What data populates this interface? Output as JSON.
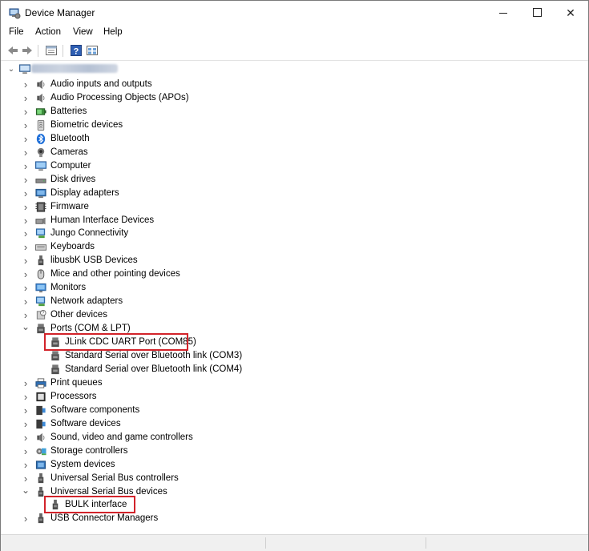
{
  "window": {
    "title": "Device Manager",
    "minimize_glyph": "—",
    "maximize_glyph": "☐",
    "close_glyph": "✕"
  },
  "menu": {
    "file": "File",
    "action": "Action",
    "view": "View",
    "help": "Help"
  },
  "toolbar": {
    "buttons": [
      "back-icon",
      "forward-icon",
      "properties-icon",
      "help-icon",
      "view-icon"
    ]
  },
  "tree": {
    "root": {
      "label_blurred": true,
      "expanded": true
    },
    "categories": [
      {
        "label": "Audio inputs and outputs",
        "icon": "speaker-icon",
        "expanded": false
      },
      {
        "label": "Audio Processing Objects (APOs)",
        "icon": "speaker-icon",
        "expanded": false
      },
      {
        "label": "Batteries",
        "icon": "battery-icon",
        "expanded": false
      },
      {
        "label": "Biometric devices",
        "icon": "fingerprint-icon",
        "expanded": false
      },
      {
        "label": "Bluetooth",
        "icon": "bluetooth-icon",
        "expanded": false
      },
      {
        "label": "Cameras",
        "icon": "camera-icon",
        "expanded": false
      },
      {
        "label": "Computer",
        "icon": "computer-icon",
        "expanded": false
      },
      {
        "label": "Disk drives",
        "icon": "disk-icon",
        "expanded": false
      },
      {
        "label": "Display adapters",
        "icon": "display-icon",
        "expanded": false
      },
      {
        "label": "Firmware",
        "icon": "firmware-icon",
        "expanded": false
      },
      {
        "label": "Human Interface Devices",
        "icon": "hid-icon",
        "expanded": false
      },
      {
        "label": "Jungo Connectivity",
        "icon": "network-icon",
        "expanded": false
      },
      {
        "label": "Keyboards",
        "icon": "keyboard-icon",
        "expanded": false
      },
      {
        "label": "libusbK USB Devices",
        "icon": "usb-icon",
        "expanded": false
      },
      {
        "label": "Mice and other pointing devices",
        "icon": "mouse-icon",
        "expanded": false
      },
      {
        "label": "Monitors",
        "icon": "monitor-icon",
        "expanded": false
      },
      {
        "label": "Network adapters",
        "icon": "network-icon",
        "expanded": false
      },
      {
        "label": "Other devices",
        "icon": "unknown-device-icon",
        "expanded": false
      },
      {
        "label": "Ports (COM & LPT)",
        "icon": "port-icon",
        "expanded": true
      },
      {
        "label": "JLink CDC UART Port (COM85)",
        "icon": "port-icon",
        "child": true,
        "highlighted": true
      },
      {
        "label": "Standard Serial over Bluetooth link (COM3)",
        "icon": "port-icon",
        "child": true
      },
      {
        "label": "Standard Serial over Bluetooth link (COM4)",
        "icon": "port-icon",
        "child": true
      },
      {
        "label": "Print queues",
        "icon": "printer-icon",
        "expanded": false
      },
      {
        "label": "Processors",
        "icon": "processor-icon",
        "expanded": false
      },
      {
        "label": "Software components",
        "icon": "software-icon",
        "expanded": false
      },
      {
        "label": "Software devices",
        "icon": "software-icon",
        "expanded": false
      },
      {
        "label": "Sound, video and game controllers",
        "icon": "speaker-icon",
        "expanded": false
      },
      {
        "label": "Storage controllers",
        "icon": "storage-icon",
        "expanded": false
      },
      {
        "label": "System devices",
        "icon": "system-icon",
        "expanded": false
      },
      {
        "label": "Universal Serial Bus controllers",
        "icon": "usb-icon",
        "expanded": false
      },
      {
        "label": "Universal Serial Bus devices",
        "icon": "usb-icon",
        "expanded": true
      },
      {
        "label": "BULK interface",
        "icon": "usb-icon",
        "child": true,
        "highlighted": true
      },
      {
        "label": "USB Connector Managers",
        "icon": "usb-icon",
        "expanded": false
      }
    ]
  },
  "colors": {
    "highlight_box": "#d2232a",
    "window_border": "#7a7a7a"
  }
}
